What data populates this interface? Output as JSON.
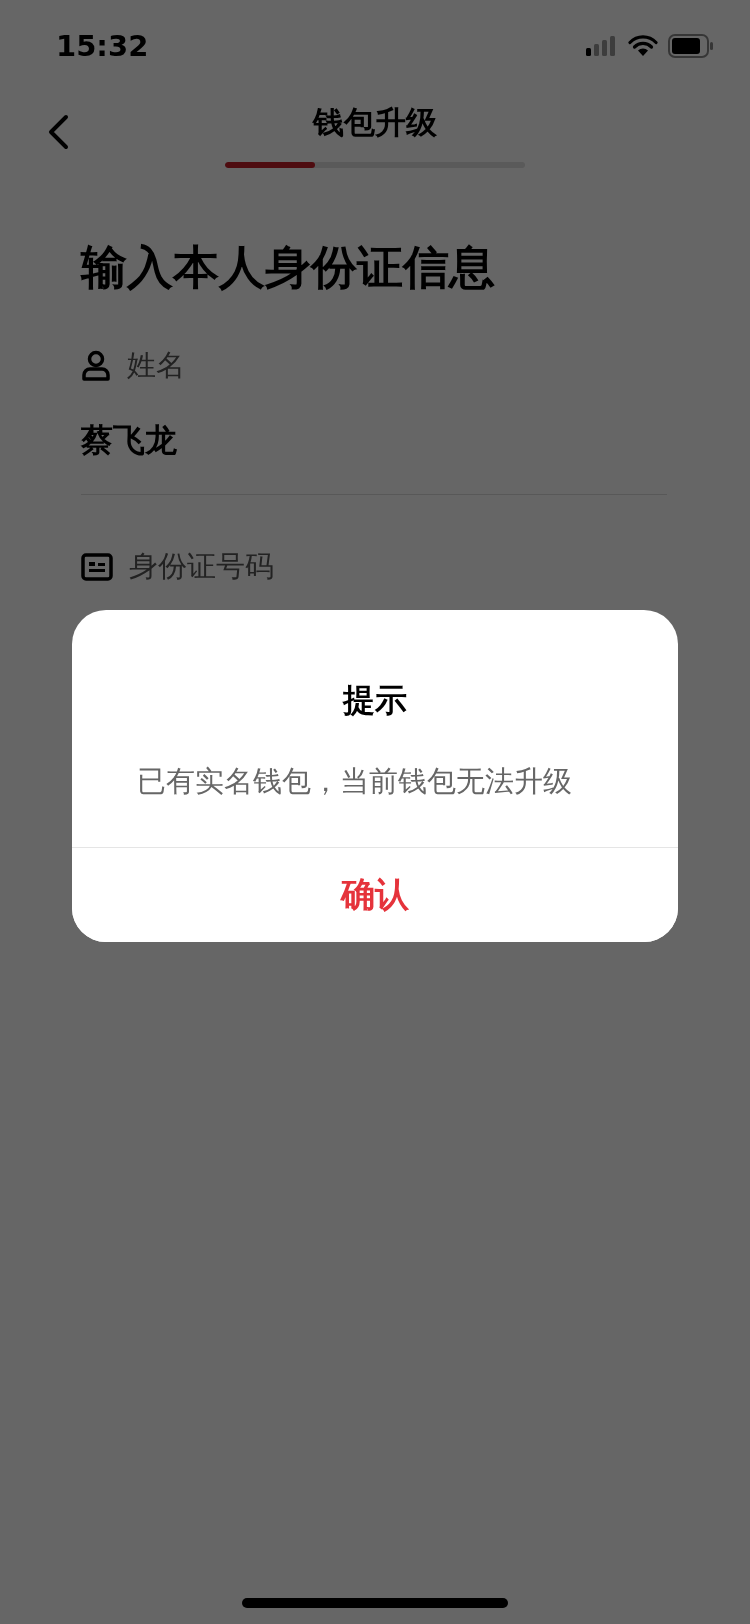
{
  "status_bar": {
    "time": "15:32"
  },
  "header": {
    "title": "钱包升级",
    "progress": {
      "level": 0.3
    }
  },
  "heading": "输入本人身份证信息",
  "fields": [
    {
      "kind": "person",
      "label": "姓名",
      "value": "蔡飞龙"
    },
    {
      "kind": "id-card",
      "label": "身份证号码"
    }
  ],
  "dialog": {
    "title": "提示",
    "message": "已有实名钱包，当前钱包无法升级",
    "button": "确认"
  }
}
